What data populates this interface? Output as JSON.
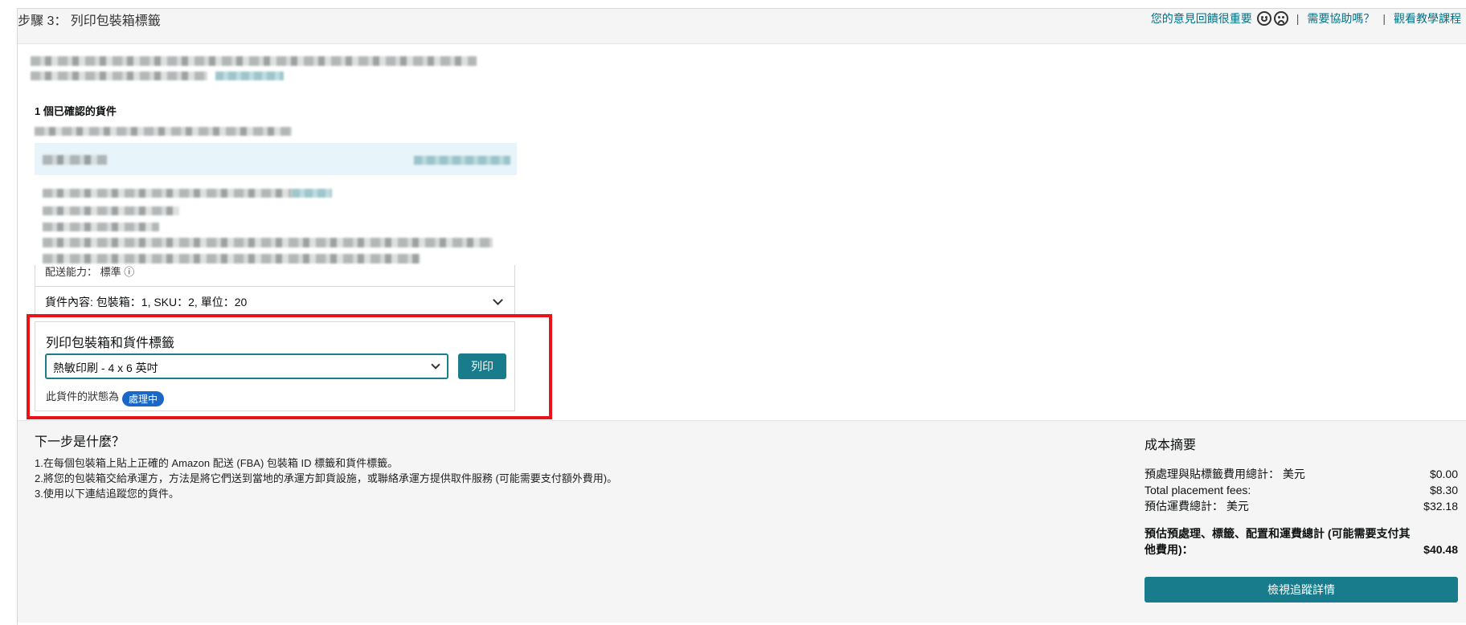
{
  "header": {
    "step_title": "步驟 3： 列印包裝箱標籤",
    "feedback_link": "您的意見回饋很重要",
    "help_link": "需要協助嗎？",
    "tutorial_link": "觀看教學課程",
    "separator": "|"
  },
  "shipments": {
    "heading": "1 個已確認的貨件",
    "partial_row": "配送能力： 標準 ⓘ",
    "contents": "貨件內容: 包裝箱：1, SKU：2, 單位：20"
  },
  "print_panel": {
    "title": "列印包裝箱和貨件標籤",
    "select_value": "熱敏印刷 - 4 x 6 英吋",
    "print_button": "列印",
    "status_label": "此貨件的狀態為",
    "status_badge": "處理中"
  },
  "next_steps": {
    "title": "下一步是什麼？",
    "items": [
      "1.在每個包裝箱上貼上正確的 Amazon 配送 (FBA) 包裝箱 ID 標籤和貨件標籤。",
      "2.將您的包裝箱交給承運方，方法是將它們送到當地的承運方卸貨設施，或聯絡承運方提供取件服務 (可能需要支付額外費用)。",
      "3.使用以下連結追蹤您的貨件。"
    ]
  },
  "cost_summary": {
    "title": "成本摘要",
    "rows": [
      {
        "label": "預處理與貼標籤費用總計： 美元",
        "value": "$0.00"
      },
      {
        "label": "Total placement fees:",
        "value": "$8.30"
      },
      {
        "label": "預估運費總計： 美元",
        "value": "$32.18"
      }
    ],
    "total_label": "預估預處理、標籤、配置和運費總計 (可能需要支付其他費用)：",
    "total_value": "$40.48",
    "track_button": "檢視追蹤詳情"
  },
  "colors": {
    "accent": "#187c8c",
    "link": "#007185",
    "highlight": "#e8141a",
    "badge": "#1a67c7"
  }
}
